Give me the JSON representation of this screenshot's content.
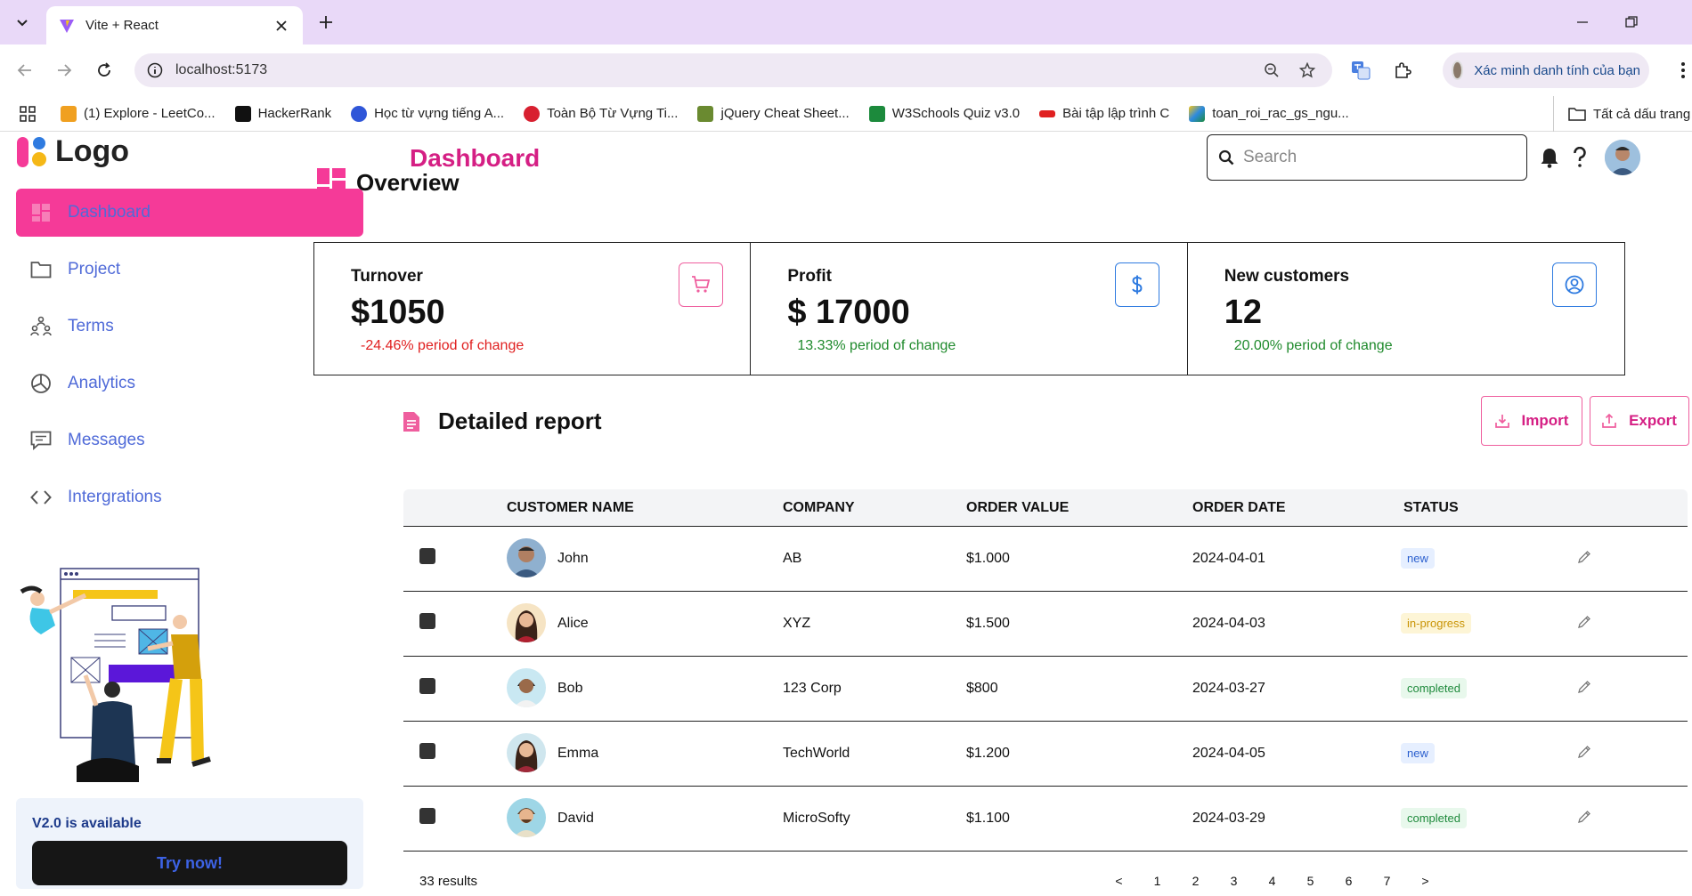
{
  "browser": {
    "tab_title": "Vite + React",
    "url": "localhost:5173",
    "profile_text": "Xác minh danh tính của bạn",
    "bookmarks": [
      {
        "label": "(1) Explore - LeetCo...",
        "color": "#f0a020"
      },
      {
        "label": "HackerRank",
        "color": "#111111"
      },
      {
        "label": "Học từ vựng tiếng A...",
        "color": "#2f56d8"
      },
      {
        "label": "Toàn Bộ Từ Vựng Ti...",
        "color": "#d82030"
      },
      {
        "label": "jQuery Cheat Sheet...",
        "color": "#6a8a30"
      },
      {
        "label": "W3Schools Quiz v3.0",
        "color": "#1c8a3c"
      },
      {
        "label": "Bài tập lập trình C",
        "color": "#e02020"
      },
      {
        "label": "toan_roi_rac_gs_ngu...",
        "color": "#2d8ae0"
      }
    ],
    "bookmarks_folder": "Tất cả dấu trang"
  },
  "sidebar": {
    "logo_text": "Logo",
    "nav": [
      {
        "label": "Dashboard",
        "icon": "grid-icon",
        "active": true
      },
      {
        "label": "Project",
        "icon": "folder-icon"
      },
      {
        "label": "Terms",
        "icon": "team-icon"
      },
      {
        "label": "Analytics",
        "icon": "pie-chart-icon"
      },
      {
        "label": "Messages",
        "icon": "message-icon"
      },
      {
        "label": "Intergrations",
        "icon": "code-icon"
      }
    ],
    "promo_text": "V2.0 is available",
    "promo_button": "Try now!"
  },
  "header": {
    "title": "Dashboard",
    "search_placeholder": "Search"
  },
  "overview": {
    "title": "Overview",
    "cards": [
      {
        "label": "Turnover",
        "value": "$1050",
        "change": "-24.46% period of change",
        "trend": "negative",
        "icon": "cart-icon",
        "icon_color": "#ef5e9e"
      },
      {
        "label": "Profit",
        "value": "$ 17000",
        "change": "13.33% period of change",
        "trend": "positive",
        "icon": "dollar-icon",
        "icon_color": "#2f7be0"
      },
      {
        "label": "New customers",
        "value": "12",
        "change": "20.00% period of change",
        "trend": "positive",
        "icon": "user-icon",
        "icon_color": "#2f7be0"
      }
    ]
  },
  "report": {
    "title": "Detailed report",
    "import_label": "Import",
    "export_label": "Export",
    "columns": [
      "CUSTOMER NAME",
      "COMPANY",
      "ORDER VALUE",
      "ORDER DATE",
      "STATUS"
    ],
    "rows": [
      {
        "name": "John",
        "company": "AB",
        "value": "$1.000",
        "date": "2024-04-01",
        "status": "new"
      },
      {
        "name": "Alice",
        "company": "XYZ",
        "value": "$1.500",
        "date": "2024-04-03",
        "status": "in-progress"
      },
      {
        "name": "Bob",
        "company": "123 Corp",
        "value": "$800",
        "date": "2024-03-27",
        "status": "completed"
      },
      {
        "name": "Emma",
        "company": "TechWorld",
        "value": "$1.200",
        "date": "2024-04-05",
        "status": "new"
      },
      {
        "name": "David",
        "company": "MicroSofty",
        "value": "$1.100",
        "date": "2024-03-29",
        "status": "completed"
      }
    ],
    "results_text": "33 results",
    "pages": [
      "<",
      "1",
      "2",
      "3",
      "4",
      "5",
      "6",
      "7",
      ">"
    ]
  },
  "colors": {
    "accent": "#f53a98",
    "title_pink": "#d51f84",
    "nav_text": "#4f6ad8",
    "negative": "#e02020",
    "positive": "#1f8a2c"
  }
}
